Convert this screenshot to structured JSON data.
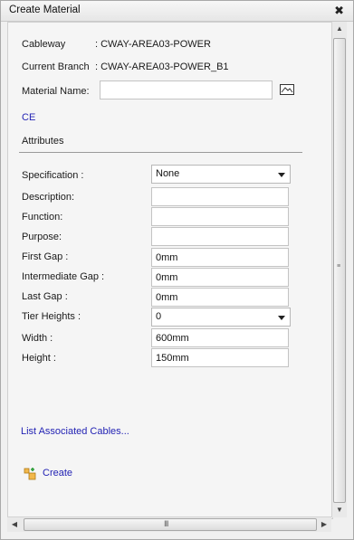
{
  "window": {
    "title": "Create Material",
    "close_glyph": "✖"
  },
  "info": [
    {
      "label": "Cableway",
      "value": ": CWAY-AREA03-POWER"
    },
    {
      "label": "Current Branch",
      "value": ": CWAY-AREA03-POWER_B1"
    }
  ],
  "material_name": {
    "label": "Material Name:",
    "value": "",
    "pick_icon": "mountain-picture-icon"
  },
  "ce_link": "CE",
  "attributes_heading": "Attributes",
  "attributes": {
    "specification": {
      "label": "Specification :",
      "value": "None"
    },
    "description": {
      "label": "Description:",
      "value": ""
    },
    "function": {
      "label": "Function:",
      "value": ""
    },
    "purpose": {
      "label": "Purpose:",
      "value": ""
    },
    "first_gap": {
      "label": "First Gap :",
      "value": "0mm"
    },
    "intermediate_gap": {
      "label": "Intermediate Gap :",
      "value": "0mm"
    },
    "last_gap": {
      "label": "Last Gap :",
      "value": "0mm"
    },
    "tier_heights": {
      "label": "Tier Heights :",
      "value": "0"
    },
    "width": {
      "label": "Width :",
      "value": "600mm"
    },
    "height": {
      "label": "Height :",
      "value": "150mm"
    }
  },
  "list_cables_link": "List Associated Cables...",
  "create_button": {
    "label": "Create",
    "icon": "create-material-icon"
  },
  "scrollbars": {
    "vertical_grip": "≡",
    "horizontal_grip": "III"
  }
}
